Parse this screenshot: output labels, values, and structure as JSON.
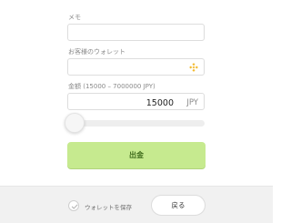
{
  "memo": {
    "label": "メモ",
    "value": ""
  },
  "wallet": {
    "label": "お客様のウォレット",
    "value": "",
    "icon": "binance-diamond-icon",
    "icon_color": "#f3ba2f"
  },
  "amount": {
    "label": "金額 (15000 – 7000000 JPY)",
    "value": "15000",
    "unit": "JPY",
    "min": 15000,
    "max": 7000000,
    "slider_fraction": 0
  },
  "withdraw_button": {
    "label": "出金",
    "color": "#c6ea8f"
  },
  "footer": {
    "save_wallet_label": "ウォレットを保存",
    "save_wallet_checked": false,
    "back_label": "戻る"
  }
}
